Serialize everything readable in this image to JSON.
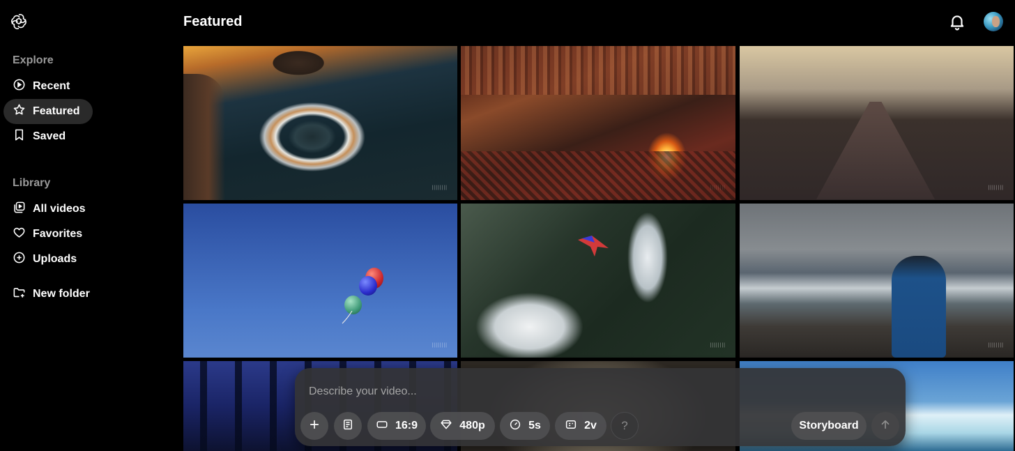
{
  "header": {
    "title": "Featured"
  },
  "sidebar": {
    "sections": [
      {
        "label": "Explore"
      },
      {
        "label": "Library"
      }
    ],
    "explore_items": [
      {
        "label": "Recent",
        "icon": "play-circle-icon"
      },
      {
        "label": "Featured",
        "icon": "star-icon",
        "active": true
      },
      {
        "label": "Saved",
        "icon": "bookmark-icon"
      }
    ],
    "library_items": [
      {
        "label": "All videos",
        "icon": "video-library-icon"
      },
      {
        "label": "Favorites",
        "icon": "heart-icon"
      },
      {
        "label": "Uploads",
        "icon": "upload-circle-icon"
      }
    ],
    "new_folder": {
      "label": "New folder",
      "icon": "folder-plus-icon"
    }
  },
  "grid": {
    "tiles": [
      {
        "name": "ocean-whirlpool-video"
      },
      {
        "name": "tent-campfire-video"
      },
      {
        "name": "vintage-car-street-video"
      },
      {
        "name": "balloons-sky-video"
      },
      {
        "name": "waterfall-wingsuit-video"
      },
      {
        "name": "man-on-beach-video"
      },
      {
        "name": "night-forest-video"
      },
      {
        "name": "sculpture-video"
      },
      {
        "name": "iceberg-video"
      }
    ]
  },
  "composer": {
    "placeholder": "Describe your video...",
    "aspect_ratio": "16:9",
    "resolution": "480p",
    "duration": "5s",
    "variations": "2v",
    "help": "?",
    "storyboard": "Storyboard"
  },
  "colors": {
    "background": "#000000",
    "sidebar_active": "#2a2a2a",
    "composer_bg": "#343436",
    "muted_label": "#9a9a9a"
  }
}
